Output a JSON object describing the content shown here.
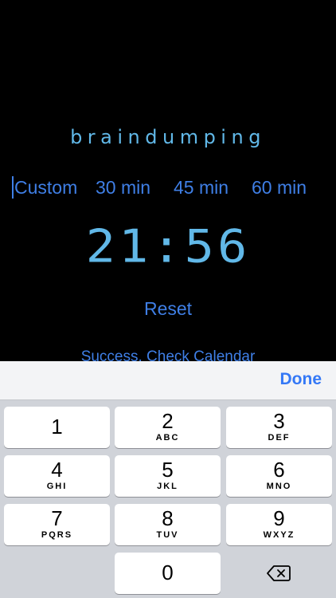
{
  "app": {
    "title": "braindumping",
    "presets": [
      "Custom",
      "30 min",
      "45 min",
      "60 min"
    ],
    "timer": "21:56",
    "reset_label": "Reset",
    "status_text": "Success, Check Calendar",
    "colors": {
      "background": "#000000",
      "accent_blue": "#3f7fe6",
      "timer_cyan": "#61b8e8"
    }
  },
  "keyboard": {
    "done_label": "Done",
    "keys": [
      {
        "num": "1",
        "letters": ""
      },
      {
        "num": "2",
        "letters": "ABC"
      },
      {
        "num": "3",
        "letters": "DEF"
      },
      {
        "num": "4",
        "letters": "GHI"
      },
      {
        "num": "5",
        "letters": "JKL"
      },
      {
        "num": "6",
        "letters": "MNO"
      },
      {
        "num": "7",
        "letters": "PQRS"
      },
      {
        "num": "8",
        "letters": "TUV"
      },
      {
        "num": "9",
        "letters": "WXYZ"
      },
      {
        "num": "0",
        "letters": ""
      }
    ],
    "backspace_icon": "backspace-icon"
  }
}
